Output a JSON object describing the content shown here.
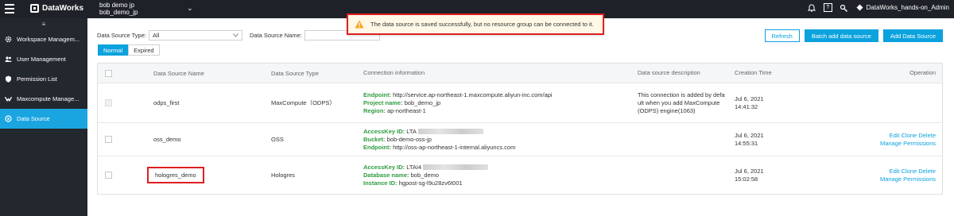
{
  "topbar": {
    "app_name": "DataWorks",
    "workspace_line1": "bob demo jp",
    "workspace_line2": "bob_demo_jp",
    "chevron": "⌄",
    "user": "DataWorks_hands-on_Admin",
    "help_icon": "?"
  },
  "sidebar": {
    "collapse_glyph": "≡",
    "items": [
      {
        "label": "Workspace Managem..."
      },
      {
        "label": "User Management"
      },
      {
        "label": "Permission List"
      },
      {
        "label": "Maxcompute Manage..."
      },
      {
        "label": "Data Source"
      }
    ]
  },
  "filters": {
    "type_label": "Data Source Type:",
    "type_value": "All",
    "name_label": "Data Source Name:",
    "name_value": ""
  },
  "toggle": {
    "normal": "Normal",
    "expired": "Expired"
  },
  "buttons": {
    "refresh": "Refresh",
    "batch_add": "Batch add data source",
    "add": "Add Data Source"
  },
  "toast": {
    "message": "The data source is saved successfully, but no resource group can be connected to it.",
    "color": "#e01f1f"
  },
  "table": {
    "headers": {
      "name": "Data Source Name",
      "type": "Data Source Type",
      "conn": "Connection information",
      "desc": "Data source description",
      "time": "Creation Time",
      "op": "Operation"
    },
    "rows": [
      {
        "name": "odps_first",
        "type": "MaxCompute（ODPS）",
        "conn": [
          {
            "k": "Endpoint:",
            "v": "http://service.ap-northeast-1.maxcompute.aliyun-inc.com/api"
          },
          {
            "k": "Project name:",
            "v": "bob_demo_jp"
          },
          {
            "k": "Region:",
            "v": "ap-northeast-1"
          }
        ],
        "desc": [
          "This connection is added by defa",
          "ult when you add MaxCompute",
          "(ODPS) engine(1063)"
        ],
        "date": "Jul 6, 2021",
        "time": "14:41:32"
      },
      {
        "name": "oss_demo",
        "type": "OSS",
        "conn": [
          {
            "k": "AccessKey ID:",
            "v": "LTA"
          },
          {
            "k": "Bucket:",
            "v": "bob-demo-oss-jp"
          },
          {
            "k": "Endpoint:",
            "v": "http://oss-ap-northeast-1-internal.aliyuncs.com"
          }
        ],
        "date": "Jul 6, 2021",
        "time": "14:55:31",
        "ops": {
          "edit": "Edit",
          "clone": "Clone",
          "delete": "Delete",
          "manage": "Manage Permissions"
        }
      },
      {
        "name": "hologres_demo",
        "type": "Hologres",
        "conn": [
          {
            "k": "AccessKey ID:",
            "v": "LTAI4"
          },
          {
            "k": "Database name:",
            "v": "bob_demo"
          },
          {
            "k": "Instance ID:",
            "v": "hgpost-sg-l9u28zv6t001"
          }
        ],
        "date": "Jul 6, 2021",
        "time": "15:02:58",
        "ops": {
          "edit": "Edit",
          "clone": "Clone",
          "delete": "Delete",
          "manage": "Manage Permissions"
        }
      }
    ]
  }
}
